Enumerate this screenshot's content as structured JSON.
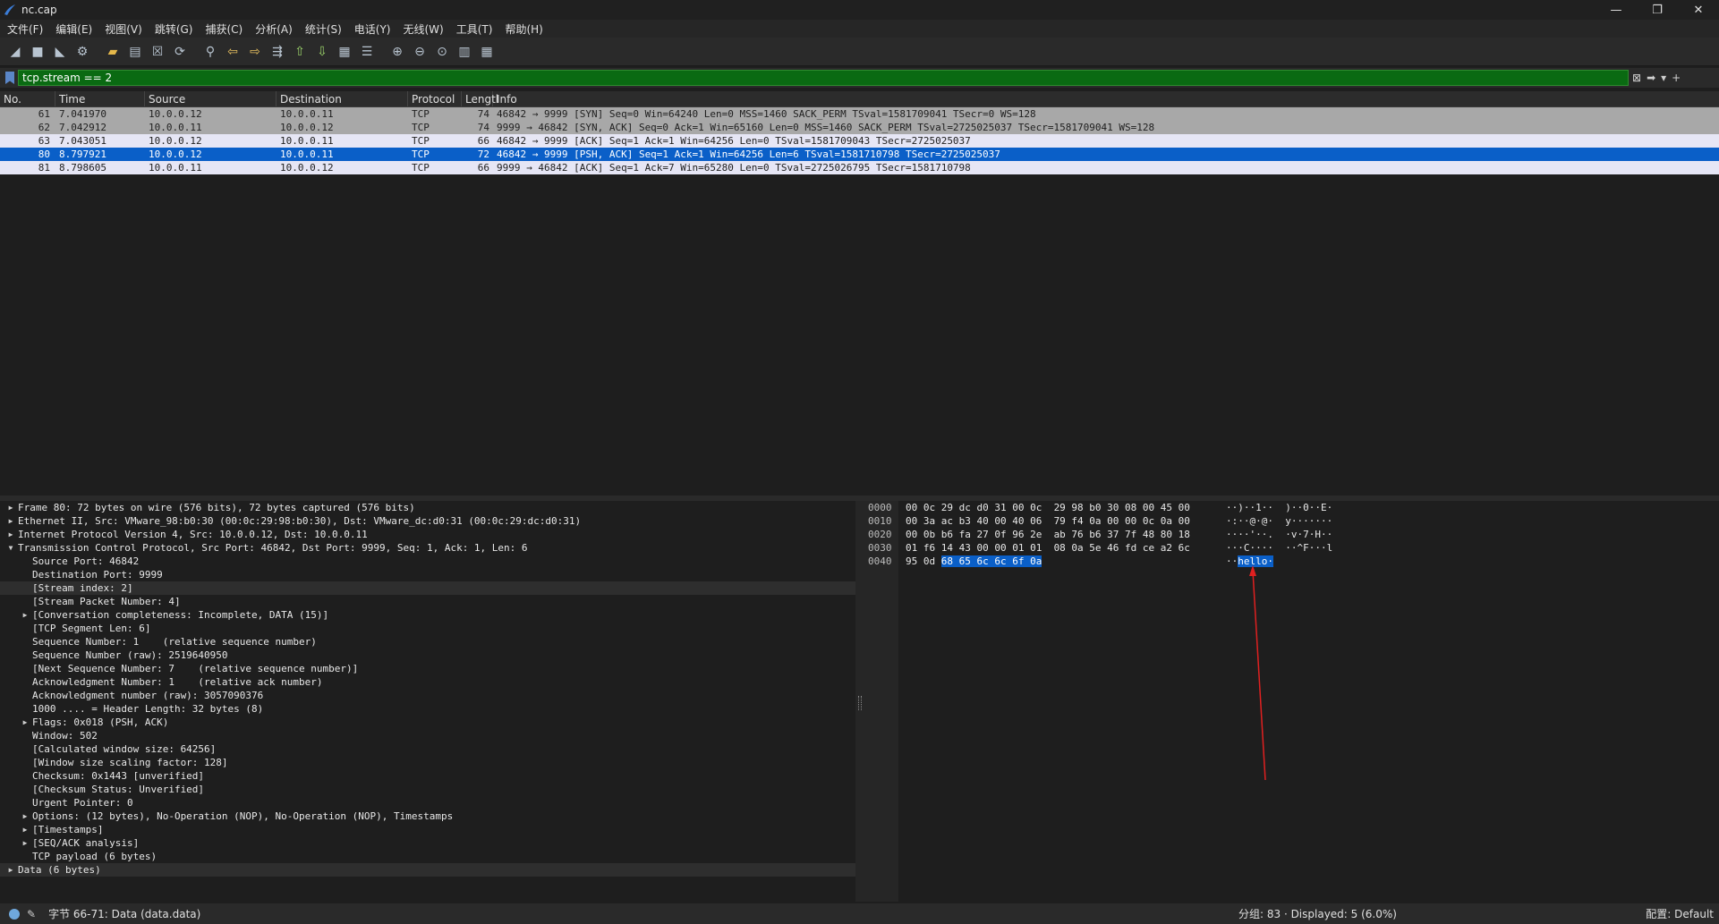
{
  "window": {
    "title": "nc.cap",
    "min": "—",
    "max": "❐",
    "close": "✕"
  },
  "menu": [
    "文件(F)",
    "编辑(E)",
    "视图(V)",
    "跳转(G)",
    "捕获(C)",
    "分析(A)",
    "统计(S)",
    "电话(Y)",
    "无线(W)",
    "工具(T)",
    "帮助(H)"
  ],
  "toolbar": {
    "icons": [
      "shark-fin-start-icon",
      "stop-icon",
      "restart-icon",
      "options-gear-icon",
      "open-folder-icon",
      "save-icon",
      "close-file-icon",
      "reload-icon",
      "find-icon",
      "back-arrow-icon",
      "forward-arrow-icon",
      "goto-icon",
      "first-icon",
      "last-icon",
      "autoscroll-icon",
      "colorize-icon",
      "zoom-in-icon",
      "zoom-out-icon",
      "zoom-reset-icon",
      "resize-columns-icon",
      "layout-icon"
    ]
  },
  "filter": {
    "value": "tcp.stream == 2"
  },
  "packet_list": {
    "headers": {
      "no": "No.",
      "time": "Time",
      "source": "Source",
      "destination": "Destination",
      "protocol": "Protocol",
      "length": "Lengtl",
      "info": "Info"
    },
    "rows": [
      {
        "no": "61",
        "time": "7.041970",
        "source": "10.0.0.12",
        "destination": "10.0.0.11",
        "protocol": "TCP",
        "length": "74",
        "info": "46842 → 9999 [SYN] Seq=0 Win=64240 Len=0 MSS=1460 SACK_PERM TSval=1581709041 TSecr=0 WS=128",
        "style": "gray"
      },
      {
        "no": "62",
        "time": "7.042912",
        "source": "10.0.0.11",
        "destination": "10.0.0.12",
        "protocol": "TCP",
        "length": "74",
        "info": "9999 → 46842 [SYN, ACK] Seq=0 Ack=1 Win=65160 Len=0 MSS=1460 SACK_PERM TSval=2725025037 TSecr=1581709041 WS=128",
        "style": "gray"
      },
      {
        "no": "63",
        "time": "7.043051",
        "source": "10.0.0.12",
        "destination": "10.0.0.11",
        "protocol": "TCP",
        "length": "66",
        "info": "46842 → 9999 [ACK] Seq=1 Ack=1 Win=64256 Len=0 TSval=1581709043 TSecr=2725025037",
        "style": "light"
      },
      {
        "no": "80",
        "time": "8.797921",
        "source": "10.0.0.12",
        "destination": "10.0.0.11",
        "protocol": "TCP",
        "length": "72",
        "info": "46842 → 9999 [PSH, ACK] Seq=1 Ack=1 Win=64256 Len=6 TSval=1581710798 TSecr=2725025037",
        "style": "selected"
      },
      {
        "no": "81",
        "time": "8.798605",
        "source": "10.0.0.11",
        "destination": "10.0.0.12",
        "protocol": "TCP",
        "length": "66",
        "info": "9999 → 46842 [ACK] Seq=1 Ack=7 Win=65280 Len=0 TSval=2725026795 TSecr=1581710798",
        "style": "light"
      }
    ]
  },
  "details": [
    {
      "indent": 0,
      "twisty": "collapsed",
      "text": "Frame 80: 72 bytes on wire (576 bits), 72 bytes captured (576 bits)"
    },
    {
      "indent": 0,
      "twisty": "collapsed",
      "text": "Ethernet II, Src: VMware_98:b0:30 (00:0c:29:98:b0:30), Dst: VMware_dc:d0:31 (00:0c:29:dc:d0:31)"
    },
    {
      "indent": 0,
      "twisty": "collapsed",
      "text": "Internet Protocol Version 4, Src: 10.0.0.12, Dst: 10.0.0.11"
    },
    {
      "indent": 0,
      "twisty": "expanded",
      "text": "Transmission Control Protocol, Src Port: 46842, Dst Port: 9999, Seq: 1, Ack: 1, Len: 6"
    },
    {
      "indent": 1,
      "twisty": "none",
      "text": "Source Port: 46842"
    },
    {
      "indent": 1,
      "twisty": "none",
      "text": "Destination Port: 9999"
    },
    {
      "indent": 1,
      "twisty": "none",
      "text": "[Stream index: 2]"
    },
    {
      "indent": 1,
      "twisty": "none",
      "text": "[Stream Packet Number: 4]"
    },
    {
      "indent": 1,
      "twisty": "collapsed",
      "text": "[Conversation completeness: Incomplete, DATA (15)]"
    },
    {
      "indent": 1,
      "twisty": "none",
      "text": "[TCP Segment Len: 6]"
    },
    {
      "indent": 1,
      "twisty": "none",
      "text": "Sequence Number: 1    (relative sequence number)"
    },
    {
      "indent": 1,
      "twisty": "none",
      "text": "Sequence Number (raw): 2519640950"
    },
    {
      "indent": 1,
      "twisty": "none",
      "text": "[Next Sequence Number: 7    (relative sequence number)]"
    },
    {
      "indent": 1,
      "twisty": "none",
      "text": "Acknowledgment Number: 1    (relative ack number)"
    },
    {
      "indent": 1,
      "twisty": "none",
      "text": "Acknowledgment number (raw): 3057090376"
    },
    {
      "indent": 1,
      "twisty": "none",
      "text": "1000 .... = Header Length: 32 bytes (8)"
    },
    {
      "indent": 1,
      "twisty": "collapsed",
      "text": "Flags: 0x018 (PSH, ACK)"
    },
    {
      "indent": 1,
      "twisty": "none",
      "text": "Window: 502"
    },
    {
      "indent": 1,
      "twisty": "none",
      "text": "[Calculated window size: 64256]"
    },
    {
      "indent": 1,
      "twisty": "none",
      "text": "[Window size scaling factor: 128]"
    },
    {
      "indent": 1,
      "twisty": "none",
      "text": "Checksum: 0x1443 [unverified]"
    },
    {
      "indent": 1,
      "twisty": "none",
      "text": "[Checksum Status: Unverified]"
    },
    {
      "indent": 1,
      "twisty": "none",
      "text": "Urgent Pointer: 0"
    },
    {
      "indent": 1,
      "twisty": "collapsed",
      "text": "Options: (12 bytes), No-Operation (NOP), No-Operation (NOP), Timestamps"
    },
    {
      "indent": 1,
      "twisty": "collapsed",
      "text": "[Timestamps]"
    },
    {
      "indent": 1,
      "twisty": "collapsed",
      "text": "[SEQ/ACK analysis]"
    },
    {
      "indent": 1,
      "twisty": "none",
      "text": "TCP payload (6 bytes)"
    },
    {
      "indent": 0,
      "twisty": "collapsed",
      "text": "Data (6 bytes)"
    }
  ],
  "hex": {
    "rows": [
      {
        "offset": "0000",
        "bytes": "00 0c 29 dc d0 31 00 0c  29 98 b0 30 08 00 45 00",
        "ascii": "··)··1··  )··0··E·"
      },
      {
        "offset": "0010",
        "bytes": "00 3a ac b3 40 00 40 06  79 f4 0a 00 00 0c 0a 00",
        "ascii": "·:··@·@·  y·······"
      },
      {
        "offset": "0020",
        "bytes": "00 0b b6 fa 27 0f 96 2e  ab 76 b6 37 7f 48 80 18",
        "ascii": "····'··.  ·v·7·H··"
      },
      {
        "offset": "0030",
        "bytes": "01 f6 14 43 00 00 01 01  08 0a 5e 46 fd ce a2 6c",
        "ascii": "···C····  ··^F···l"
      },
      {
        "offset": "0040",
        "bytes_plain": "95 0d ",
        "bytes_highlight": "68 65 6c 6c 6f 0a",
        "ascii_plain": "··",
        "ascii_highlight": "hello·"
      }
    ]
  },
  "status": {
    "left": "字节 66-71: Data (data.data)",
    "mid": "分组: 83 · Displayed: 5 (6.0%)",
    "right": "配置: Default"
  },
  "annotation": {
    "color": "#e02020"
  }
}
